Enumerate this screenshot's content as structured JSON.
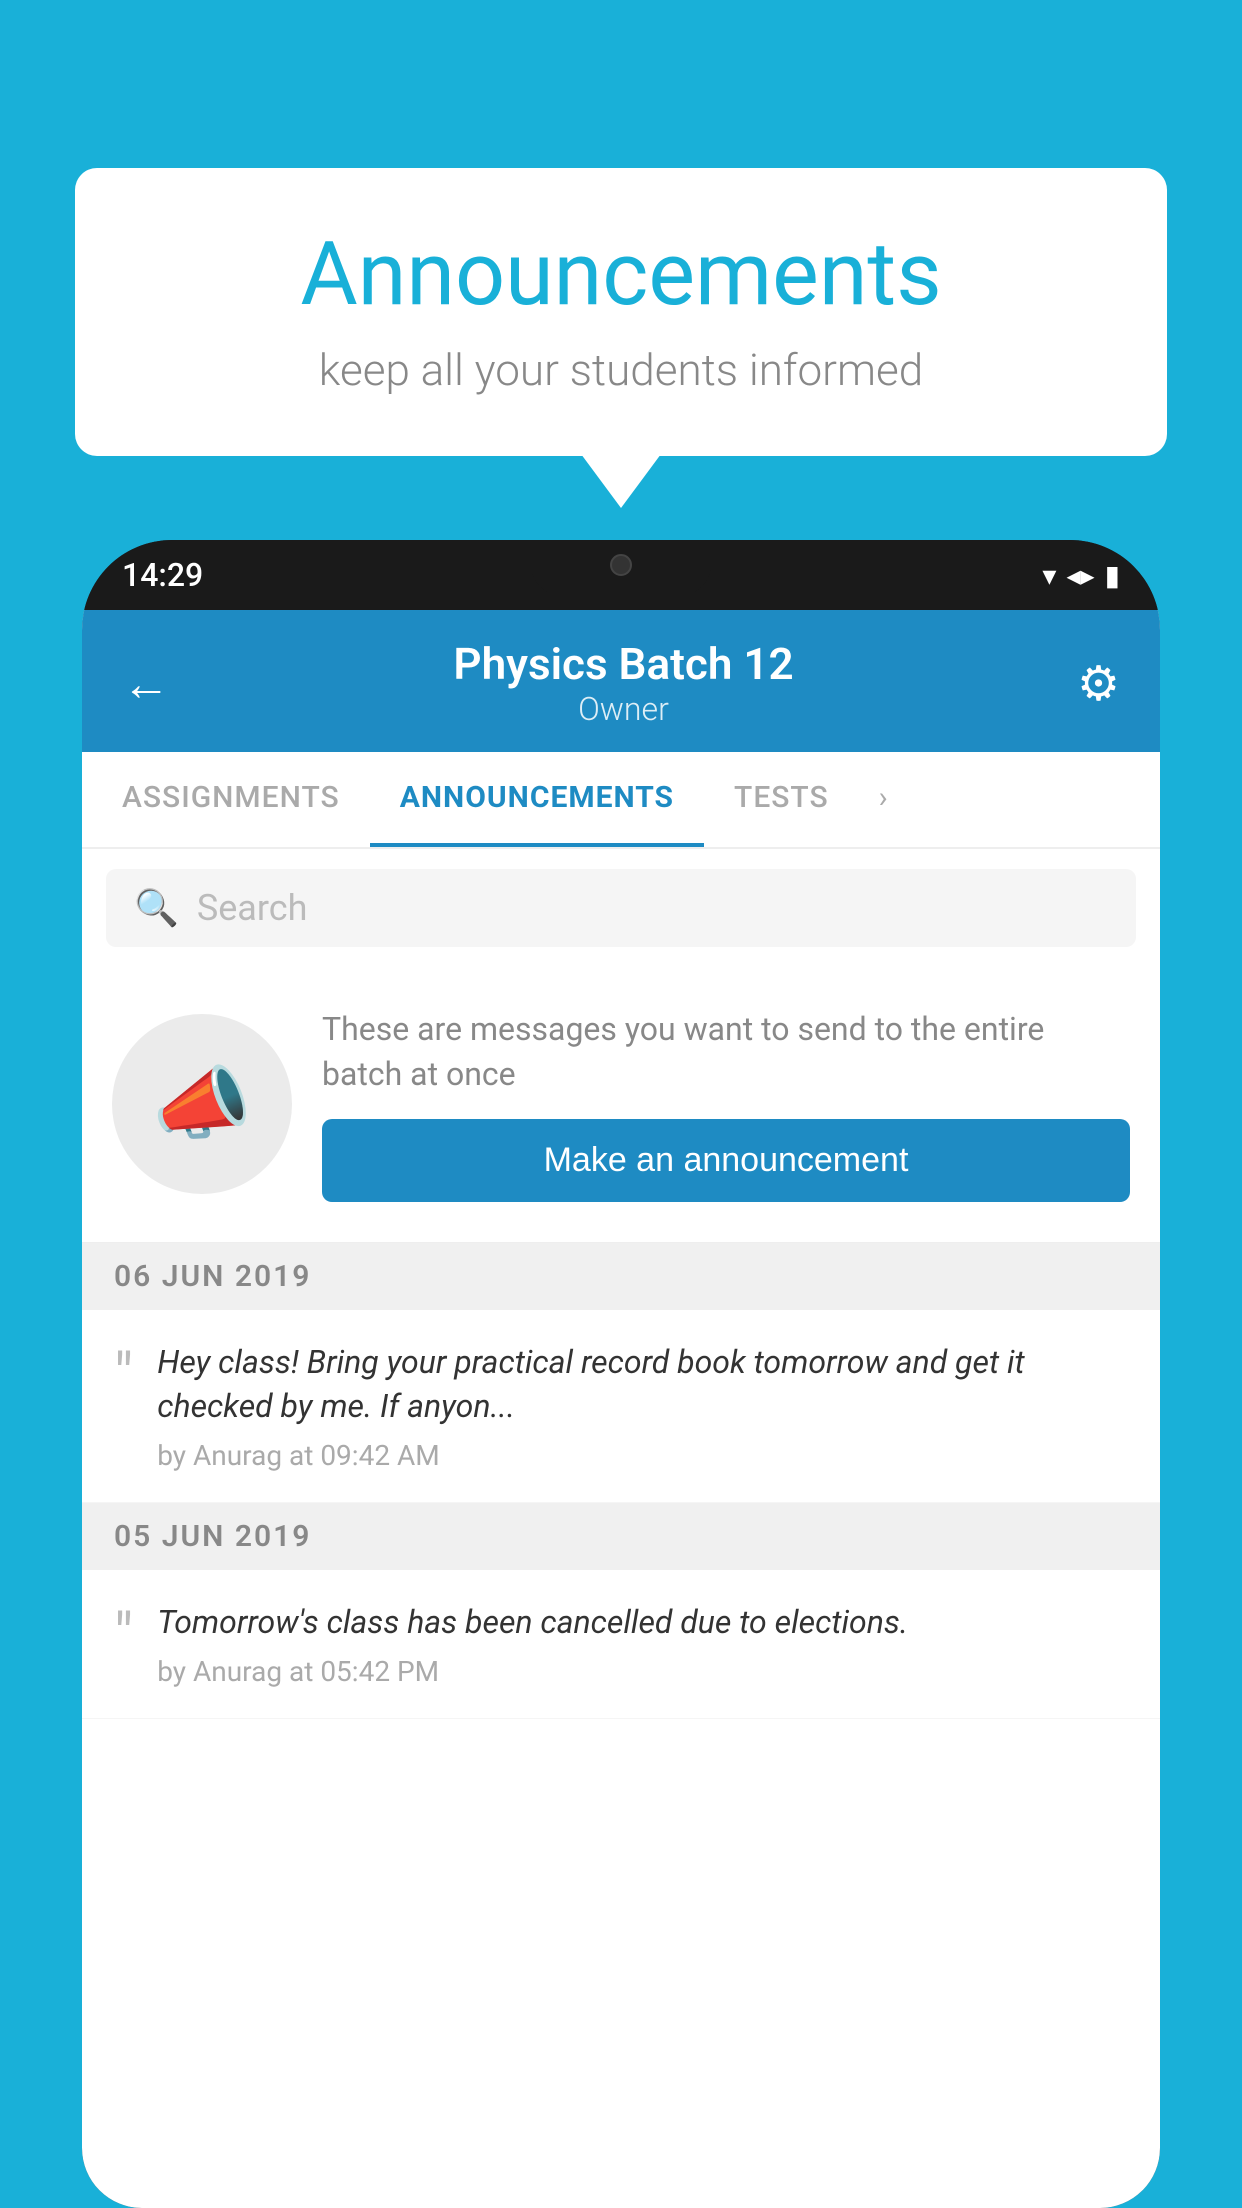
{
  "background_color": "#19b0d8",
  "speech_bubble": {
    "title": "Announcements",
    "subtitle": "keep all your students informed"
  },
  "phone": {
    "status_bar": {
      "time": "14:29"
    },
    "header": {
      "back_label": "←",
      "title": "Physics Batch 12",
      "subtitle": "Owner",
      "gear_label": "⚙"
    },
    "tabs": [
      {
        "label": "ASSIGNMENTS",
        "active": false
      },
      {
        "label": "ANNOUNCEMENTS",
        "active": true
      },
      {
        "label": "TESTS",
        "active": false
      }
    ],
    "search": {
      "placeholder": "Search"
    },
    "announcement_prompt": {
      "description": "These are messages you want to send to the entire batch at once",
      "button_label": "Make an announcement"
    },
    "date_groups": [
      {
        "date": "06  JUN  2019",
        "items": [
          {
            "text": "Hey class! Bring your practical record book tomorrow and get it checked by me. If anyon...",
            "meta": "by Anurag at 09:42 AM"
          }
        ]
      },
      {
        "date": "05  JUN  2019",
        "items": [
          {
            "text": "Tomorrow's class has been cancelled due to elections.",
            "meta": "by Anurag at 05:42 PM"
          }
        ]
      }
    ]
  }
}
